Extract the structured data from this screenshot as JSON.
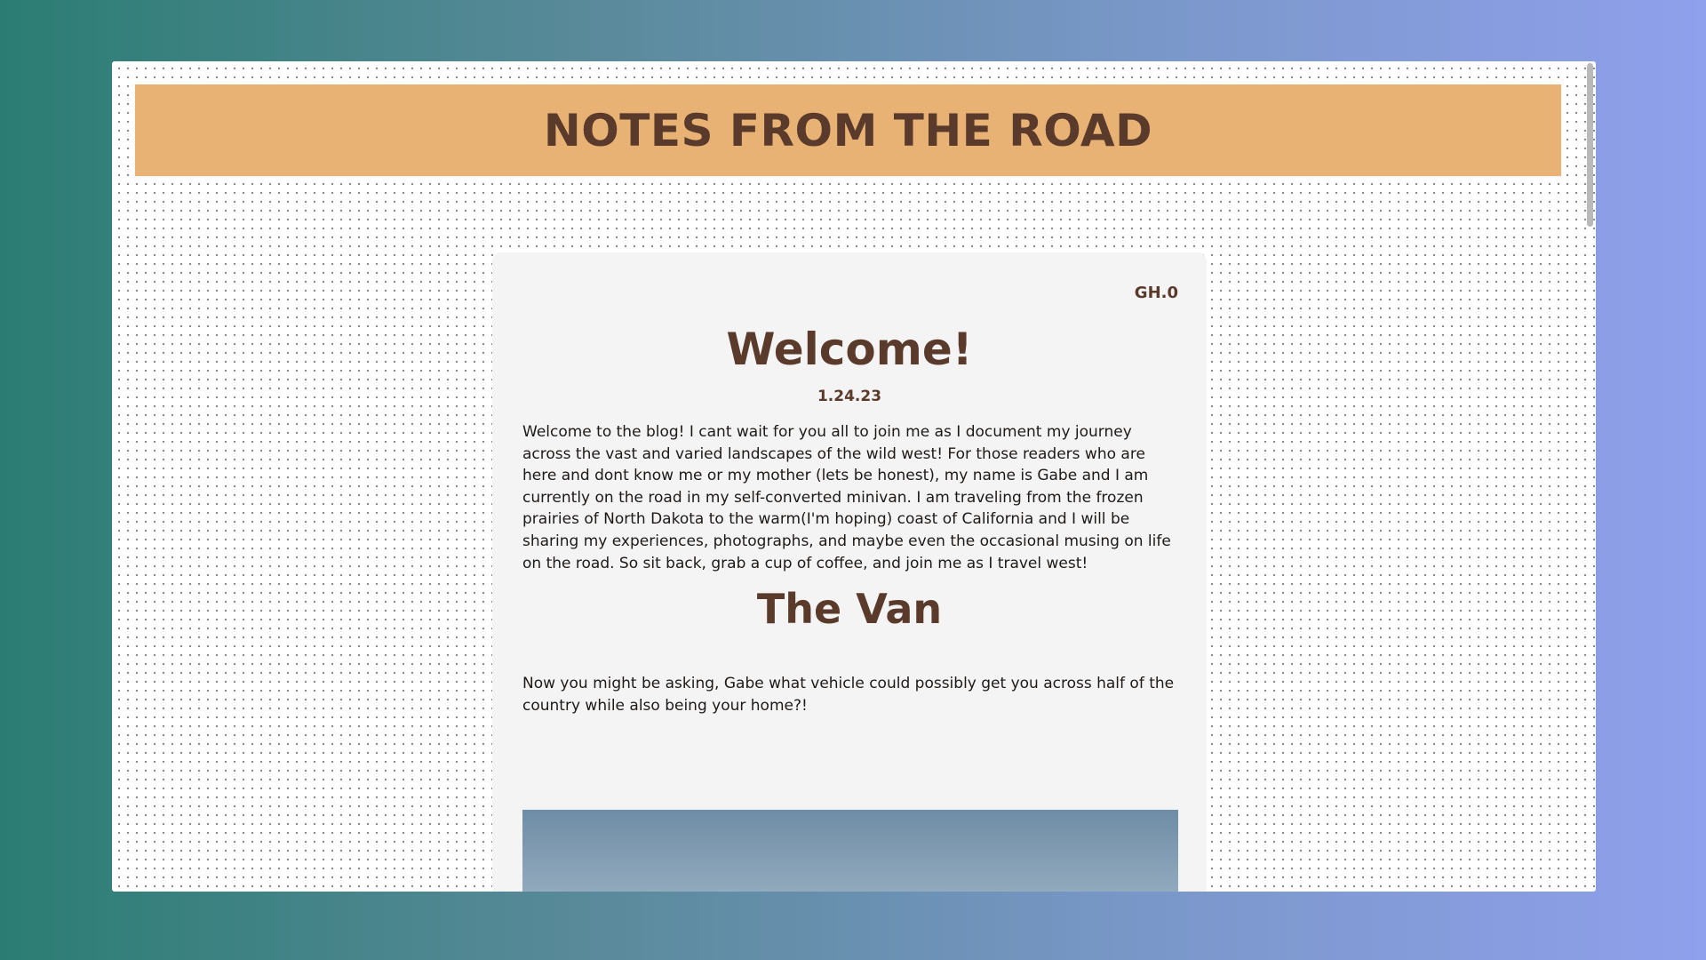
{
  "header": {
    "title": "NOTES FROM THE ROAD"
  },
  "post": {
    "tag": "GH.0",
    "title": "Welcome!",
    "date": "1.24.23",
    "intro": "Welcome to the blog! I cant wait for you all to join me as I document my journey across the vast and varied landscapes of the wild west! For those readers who are here and dont know me or my mother (lets be honest), my name is Gabe and I am currently on the road in my self-converted minivan. I am traveling from the frozen prairies of North Dakota to the warm(I'm hoping) coast of California and I will be sharing my experiences, photographs, and maybe even the occasional musing on life on the road. So sit back, grab a cup of coffee, and join me as I travel west!",
    "section_title": "The Van",
    "section_body": "Now you might be asking, Gabe what vehicle could possibly get you across half of the country while also being your home?!"
  },
  "colors": {
    "banner": "#e8b274",
    "heading": "#5a3a2b",
    "card": "#f4f4f4"
  }
}
